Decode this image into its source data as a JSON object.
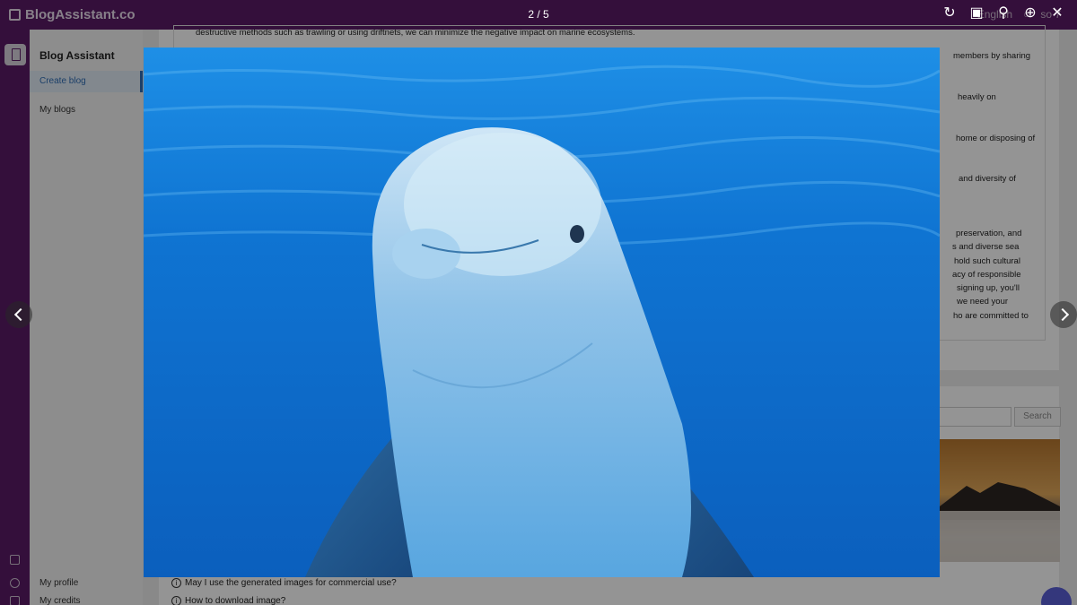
{
  "app": {
    "brand": "BlogAssistant.co"
  },
  "topbar": {
    "language": "English",
    "user": "so 7"
  },
  "sidebar": {
    "title": "Blog Assistant",
    "items": [
      {
        "label": "Create blog",
        "active": true
      },
      {
        "label": "My blogs",
        "active": false
      }
    ],
    "bottom_items": [
      {
        "label": "My profile"
      },
      {
        "label": "My credits"
      }
    ]
  },
  "article": {
    "top_line": "destructive methods such as trawling or using driftnets, we can minimize the negative impact on marine ecosystems.",
    "fragments": [
      "members by sharing",
      "heavily on",
      "home or disposing of",
      "and diversity of",
      "preservation, and",
      "s and diverse sea",
      "hold such cultural",
      "acy of responsible",
      "signing up, you'll",
      "we need your",
      "ho are committed to"
    ]
  },
  "image_search": {
    "button_label": "Search"
  },
  "faq": [
    {
      "question": "May I use the generated images for commercial use?"
    },
    {
      "question": "How to download image?"
    }
  ],
  "lightbox": {
    "counter": "2 / 5",
    "tools": [
      "rotate-icon",
      "share-icon",
      "zoom-out-icon",
      "zoom-in-icon",
      "close-icon"
    ]
  },
  "colors": {
    "brand_purple": "#5b1a66",
    "link_blue": "#2f6db5",
    "overlay": "rgba(0,0,0,0.42)"
  }
}
